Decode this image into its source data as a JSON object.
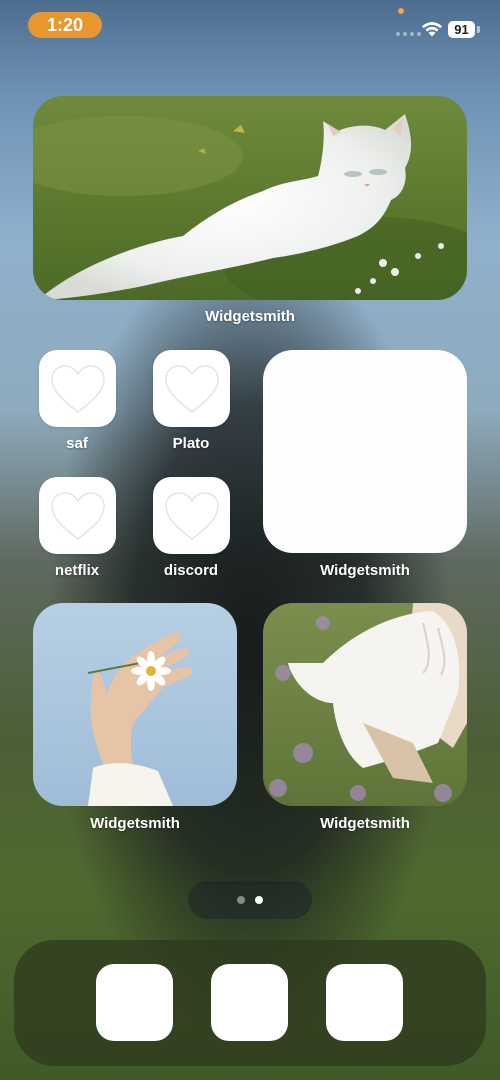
{
  "status_bar": {
    "time": "1:20",
    "battery": "91",
    "wifi_icon": "wifi-icon",
    "time_pill_color": "#e8972f"
  },
  "widgets": {
    "top": {
      "label": "Widgetsmith",
      "image": "white-cat-on-grass"
    },
    "blank": {
      "label": "Widgetsmith"
    },
    "hand": {
      "label": "Widgetsmith",
      "image": "hand-holding-daisy"
    },
    "dress": {
      "label": "Widgetsmith",
      "image": "white-blouse-in-field"
    }
  },
  "apps": [
    {
      "label": "saf",
      "icon": "heart-icon"
    },
    {
      "label": "Plato",
      "icon": "heart-icon"
    },
    {
      "label": "netflix",
      "icon": "heart-icon"
    },
    {
      "label": "discord",
      "icon": "heart-icon"
    }
  ],
  "page_indicator": {
    "pages": 2,
    "current": 2
  },
  "dock": {
    "icons": [
      "blank-app-icon",
      "blank-app-icon",
      "blank-app-icon"
    ]
  }
}
